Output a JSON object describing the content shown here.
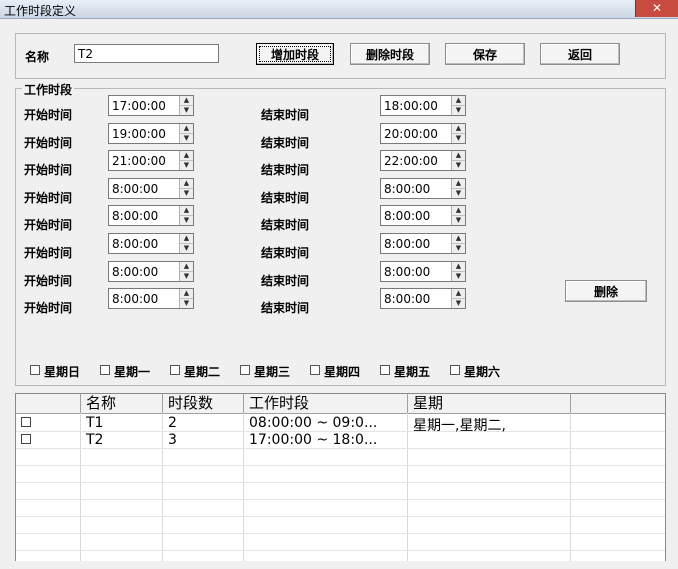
{
  "window": {
    "title": "工作时段定义",
    "close": "✕"
  },
  "top": {
    "name_label": "名称",
    "name_value": "T2",
    "buttons": {
      "add": "增加时段",
      "delete_period": "删除时段",
      "save": "保存",
      "back": "返回"
    }
  },
  "group": {
    "title": "工作时段",
    "start_label": "开始时间",
    "end_label": "结束时间",
    "rows": [
      {
        "start": "17:00:00",
        "end": "18:00:00"
      },
      {
        "start": "19:00:00",
        "end": "20:00:00"
      },
      {
        "start": "21:00:00",
        "end": "22:00:00"
      },
      {
        "start": "8:00:00",
        "end": "8:00:00"
      },
      {
        "start": "8:00:00",
        "end": "8:00:00"
      },
      {
        "start": "8:00:00",
        "end": "8:00:00"
      },
      {
        "start": "8:00:00",
        "end": "8:00:00"
      },
      {
        "start": "8:00:00",
        "end": "8:00:00"
      }
    ],
    "delete_label": "删除",
    "weekdays": [
      "星期日",
      "星期一",
      "星期二",
      "星期三",
      "星期四",
      "星期五",
      "星期六"
    ]
  },
  "table": {
    "columns": [
      "名称",
      "时段数",
      "工作时段",
      "星期"
    ],
    "rows": [
      {
        "name": "T1",
        "count": "2",
        "periods": "08:00:00 ~ 09:0...",
        "days": "星期一,星期二,"
      },
      {
        "name": "T2",
        "count": "3",
        "periods": "17:00:00 ~ 18:0...",
        "days": ""
      }
    ]
  },
  "icons": {
    "spin_up": "▲",
    "spin_down": "▼"
  }
}
